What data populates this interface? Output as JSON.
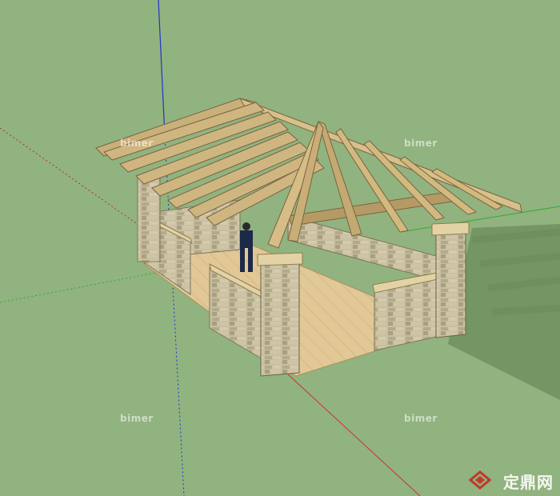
{
  "scene": {
    "subject": "timber-roof stone-pillar pavilion 3D model",
    "background_color": "#91b37f",
    "axis_colors": {
      "blue": "#2233cc",
      "red": "#cc3333",
      "green": "#33aa33"
    }
  },
  "watermarks": [
    {
      "text": "bimer"
    },
    {
      "text": "bimer"
    },
    {
      "text": "bimer"
    },
    {
      "text": "bimer"
    }
  ],
  "brand": {
    "text": "定鼎网"
  }
}
